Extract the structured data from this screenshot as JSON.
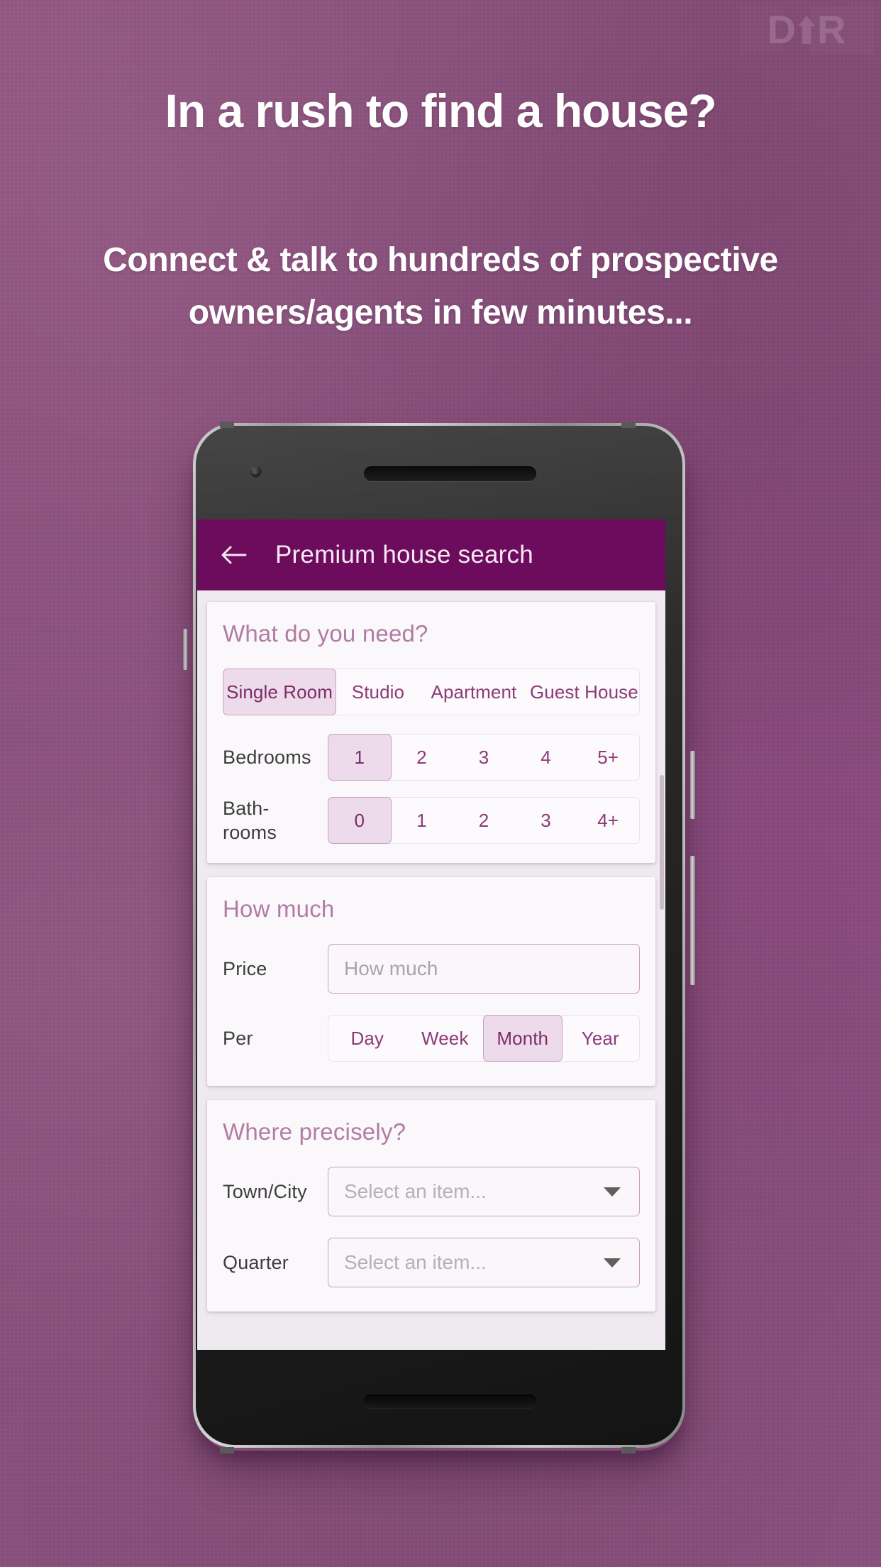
{
  "brand": {
    "logo_left": "D",
    "logo_right": "R",
    "logo_icon": "house-arrow-up-icon"
  },
  "promo": {
    "headline": "In a rush to find a house?",
    "subheadline": "Connect & talk to hundreds of prospective owners/agents in few minutes..."
  },
  "colors": {
    "background": "#8d5080",
    "appbar": "#6d0b5d",
    "section_title": "#b27ca4",
    "accent": "#8d3a77",
    "chip_selected_bg": "#eddaea",
    "chip_border": "#c9a0bf"
  },
  "app": {
    "appbar": {
      "back_icon": "arrow-left-icon",
      "title": "Premium house search"
    },
    "cards": [
      {
        "title": "What do you need?",
        "rows": [
          {
            "type": "segment",
            "label": "",
            "options": [
              "Single Room",
              "Studio",
              "Apartment",
              "Guest House"
            ],
            "selected": "Single Room"
          },
          {
            "type": "segment",
            "label": "Bedrooms",
            "options": [
              "1",
              "2",
              "3",
              "4",
              "5+"
            ],
            "selected": "1"
          },
          {
            "type": "segment",
            "label": "Bath-rooms",
            "options": [
              "0",
              "1",
              "2",
              "3",
              "4+"
            ],
            "selected": "0"
          }
        ]
      },
      {
        "title": "How much",
        "rows": [
          {
            "type": "input",
            "label": "Price",
            "placeholder": "How much",
            "value": ""
          },
          {
            "type": "segment",
            "label": "Per",
            "options": [
              "Day",
              "Week",
              "Month",
              "Year"
            ],
            "selected": "Month"
          }
        ]
      },
      {
        "title": "Where precisely?",
        "rows": [
          {
            "type": "select",
            "label": "Town/City",
            "placeholder": "Select an item...",
            "value": ""
          },
          {
            "type": "select",
            "label": "Quarter",
            "placeholder": "Select an item...",
            "value": ""
          }
        ]
      }
    ]
  }
}
